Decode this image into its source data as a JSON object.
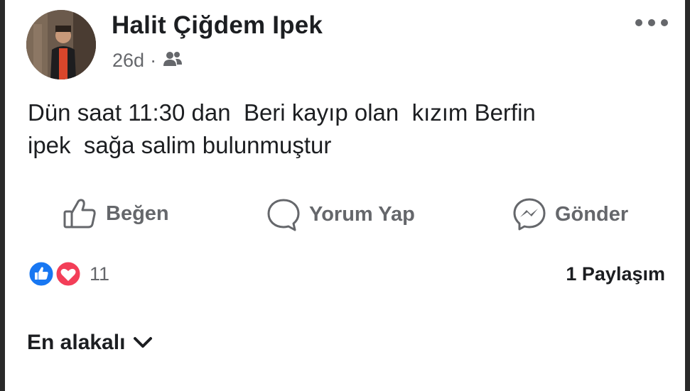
{
  "post": {
    "author": "Halit Çiğdem Ipek",
    "time": "26d",
    "separator": "·",
    "audience_icon": "friends-icon",
    "text_line1": "Dün saat 11:30 dan  Beri kayıp olan  kızım Berfin",
    "text_line2": "ipek  sağa salim bulunmuştur"
  },
  "actions": {
    "like_label": "Beğen",
    "comment_label": "Yorum Yap",
    "send_label": "Gönder"
  },
  "reactions": {
    "count": "11",
    "types": [
      "like-icon",
      "love-icon"
    ],
    "like_color": "#1877f2",
    "love_color": "#f33e58"
  },
  "shares": "1 Paylaşım",
  "comments": {
    "sort_label": "En alakalı"
  }
}
